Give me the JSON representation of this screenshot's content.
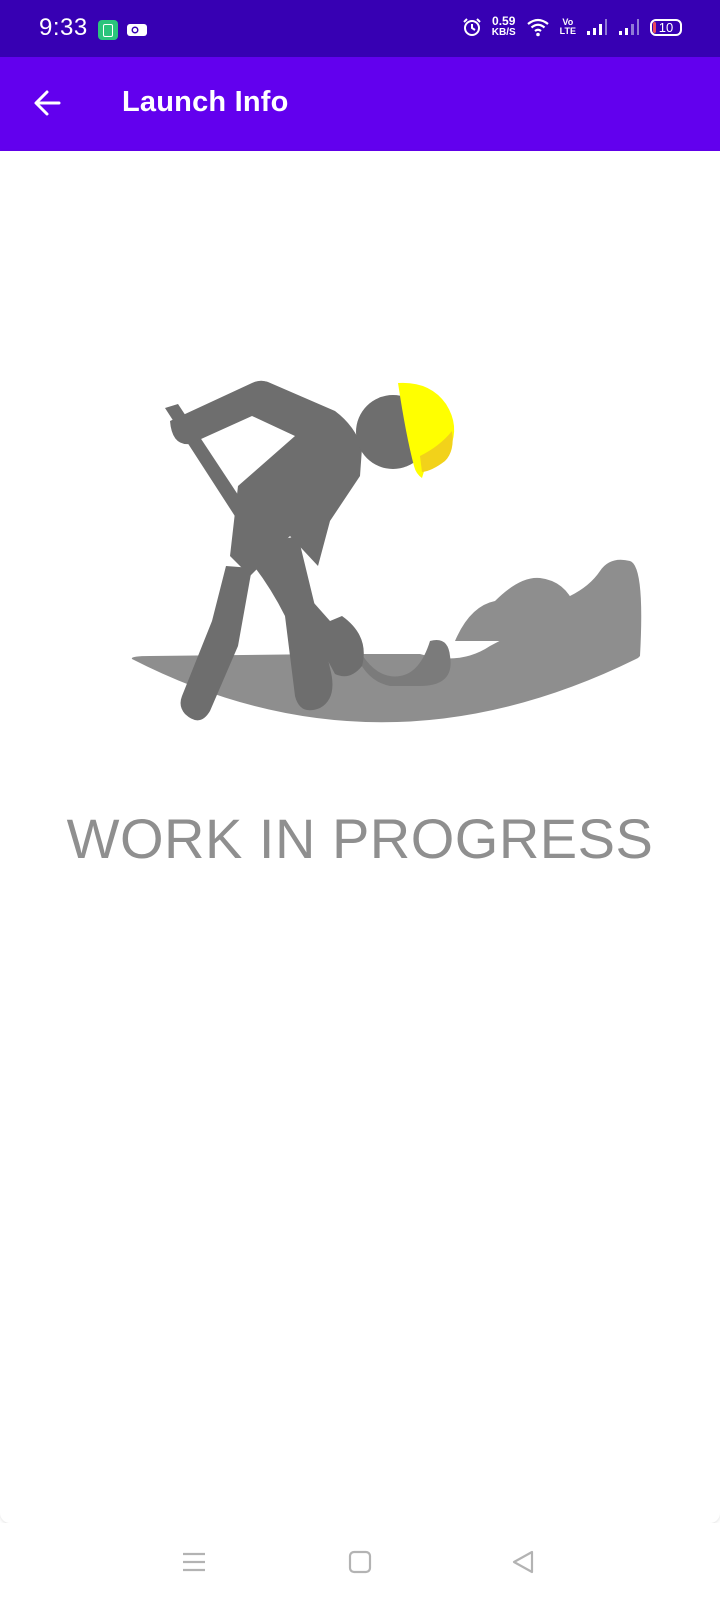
{
  "status_bar": {
    "time": "9:33",
    "network_speed_value": "0.59",
    "network_speed_unit": "KB/S",
    "volte_top": "Vo",
    "volte_bottom": "LTE",
    "battery_level": "10",
    "icons": [
      "battery-saver-icon",
      "video-camera-icon",
      "alarm-icon",
      "wifi-icon",
      "volte-icon",
      "signal-icon",
      "signal-icon",
      "battery-icon"
    ],
    "background_color": "#3700b3"
  },
  "app_bar": {
    "title": "Launch Info",
    "back_icon": "arrow-back-icon",
    "background_color": "#6200ee"
  },
  "content": {
    "illustration": "work-in-progress-illustration",
    "message": "WORK IN PROGRESS",
    "helmet_color": "#ffff00",
    "figure_color": "#6e6e6e"
  },
  "nav_bar": {
    "icons": [
      "menu-icon",
      "home-square-icon",
      "back-triangle-icon"
    ]
  }
}
